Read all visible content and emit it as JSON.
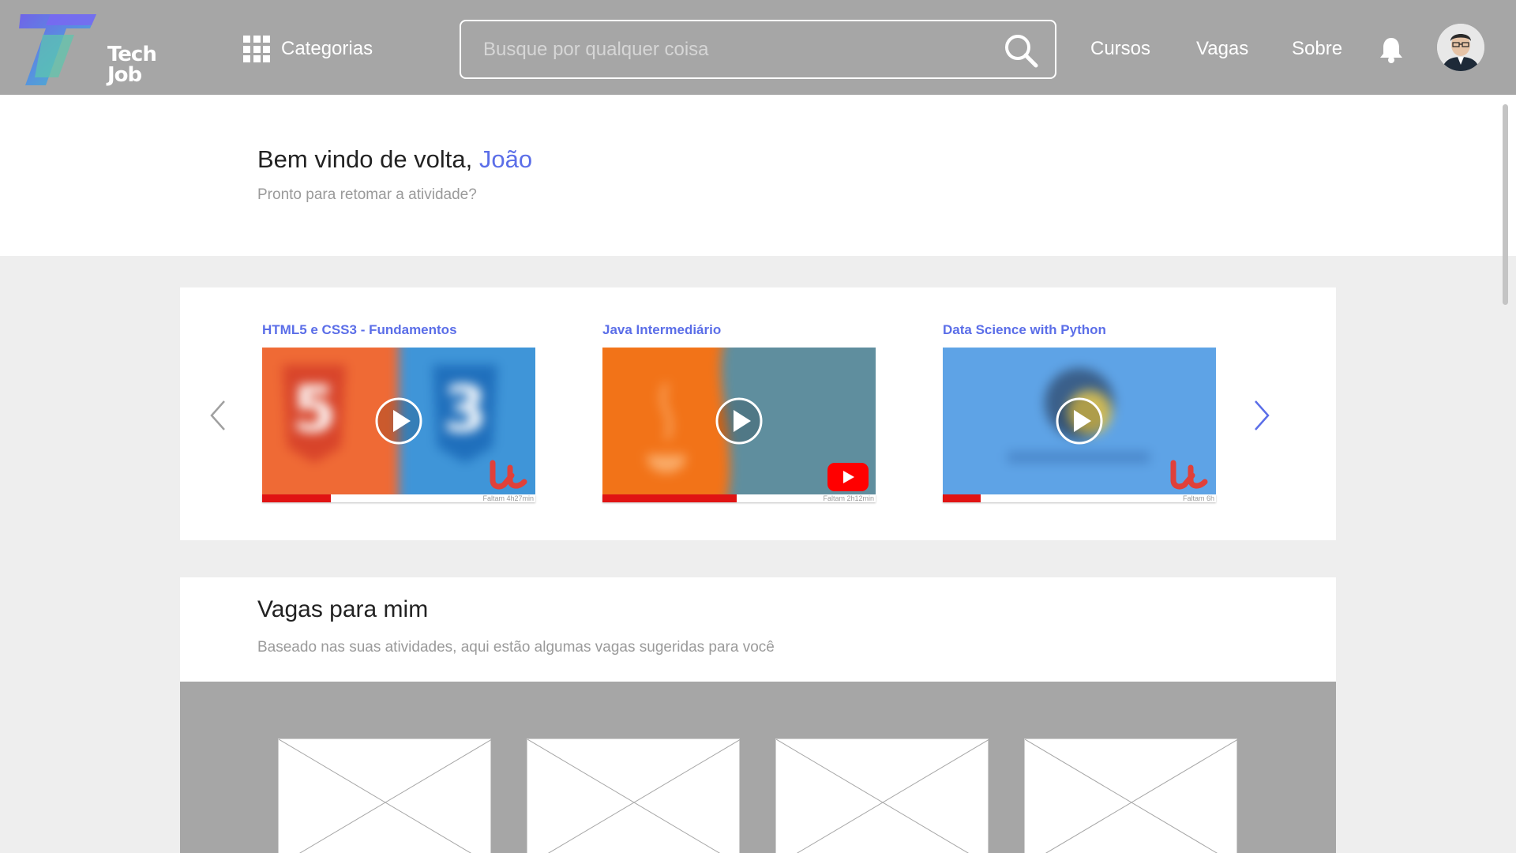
{
  "header": {
    "logo_text_top": "Tech",
    "logo_text_bottom": "Job",
    "categories_label": "Categorias",
    "search_placeholder": "Busque por qualquer coisa",
    "nav": [
      "Cursos",
      "Vagas",
      "Sobre"
    ]
  },
  "welcome": {
    "greeting": "Bem vindo de volta,",
    "name": "João",
    "subtitle": "Pronto para retomar a atividade?"
  },
  "courses": [
    {
      "title": "HTML5 e CSS3 - Fundamentos",
      "remaining": "Faltam 4h27min",
      "progress": 0.25,
      "platform": "udemy-icon"
    },
    {
      "title": "Java Intermediário",
      "remaining": "Faltam 2h12min",
      "progress": 0.49,
      "platform": "youtube-icon"
    },
    {
      "title": "Data Science with Python",
      "remaining": "Faltam 6h",
      "progress": 0.14,
      "platform": "udemy-icon"
    }
  ],
  "jobs": {
    "title": "Vagas para mim",
    "subtitle": "Baseado nas suas atividades, aqui estão algumas vagas sugeridas para você",
    "card_count": 4
  },
  "colors": {
    "header_bg": "#a6a6a6",
    "accent": "#5b6ee8",
    "progress": "#e01313"
  }
}
